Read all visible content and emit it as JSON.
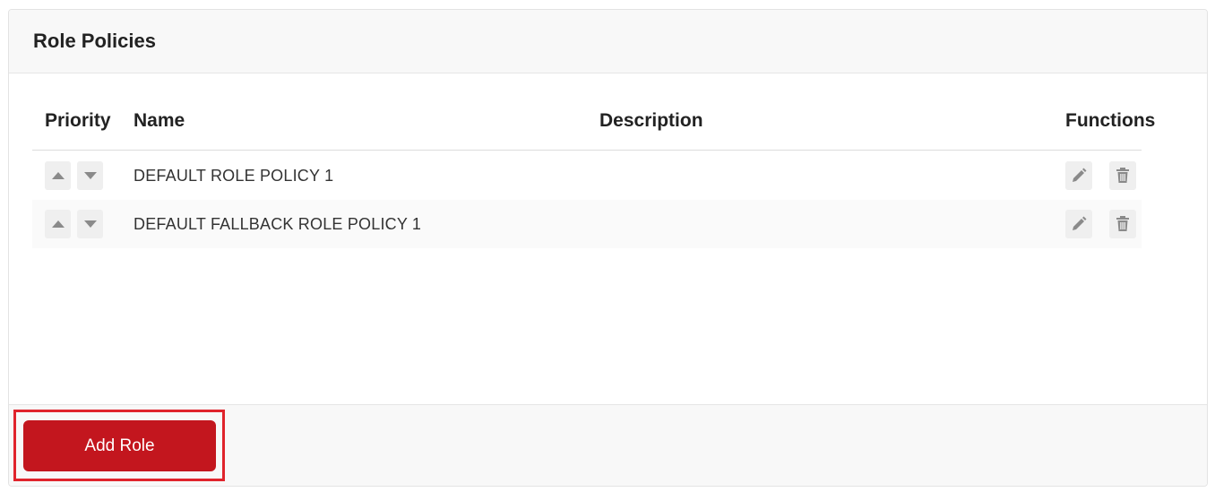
{
  "panel": {
    "title": "Role Policies"
  },
  "table": {
    "columns": {
      "priority": "Priority",
      "name": "Name",
      "description": "Description",
      "functions": "Functions"
    },
    "rows": [
      {
        "name": "DEFAULT ROLE POLICY 1",
        "description": ""
      },
      {
        "name": "DEFAULT FALLBACK ROLE POLICY 1",
        "description": ""
      }
    ]
  },
  "icons": {
    "move_up": "triangle-up-icon",
    "move_down": "triangle-down-icon",
    "edit": "pencil-icon",
    "delete": "trash-icon"
  },
  "footer": {
    "add_button_label": "Add Role"
  },
  "colors": {
    "accent": "#c3161e",
    "highlight": "#e0242c",
    "icon": "#8a8a8a"
  }
}
